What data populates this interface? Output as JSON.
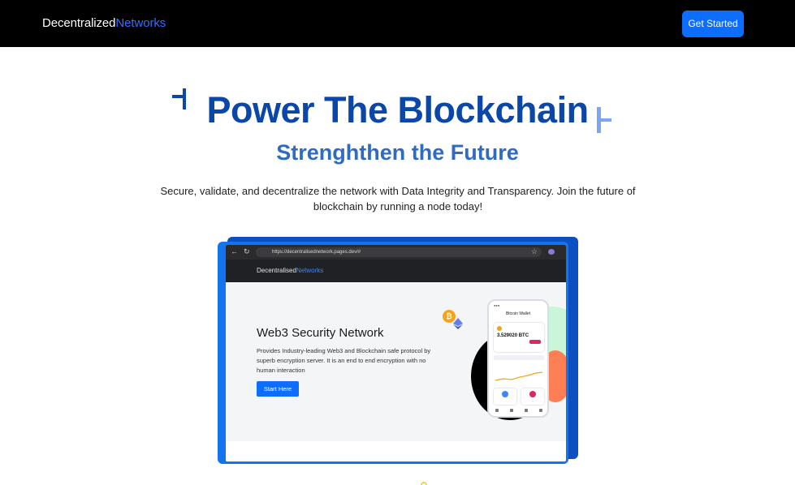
{
  "header": {
    "brand_primary": "Decentralized",
    "brand_accent": "Networks",
    "cta_label": "Get Started"
  },
  "hero": {
    "title": "Power The Blockchain",
    "subtitle": "Strenghthen the Future",
    "description": "Secure, validate, and decentralize the network with Data Integrity and Transparency. Join the future of blockchain by running a node today!"
  },
  "preview": {
    "url": "https://decentralisednetwork.pages.dev/#",
    "site_brand_primary": "Decentralised",
    "site_brand_accent": "Networks",
    "site_heading": "Web3 Security Network",
    "site_paragraph": "Provides Industry-leading Web3 and Blockchain safe protocol by superb encryption server. It is an end to end encryption with no human interaction",
    "site_button": "Start Here",
    "phone": {
      "title": "Bitcoin Wallet",
      "amount": "3.529020 BTC"
    }
  },
  "colors": {
    "brand_accent": "#2f6fff",
    "title_blue": "#0b47a8",
    "subtitle_blue": "#2f6bc0",
    "button_blue": "#0d6efd"
  }
}
